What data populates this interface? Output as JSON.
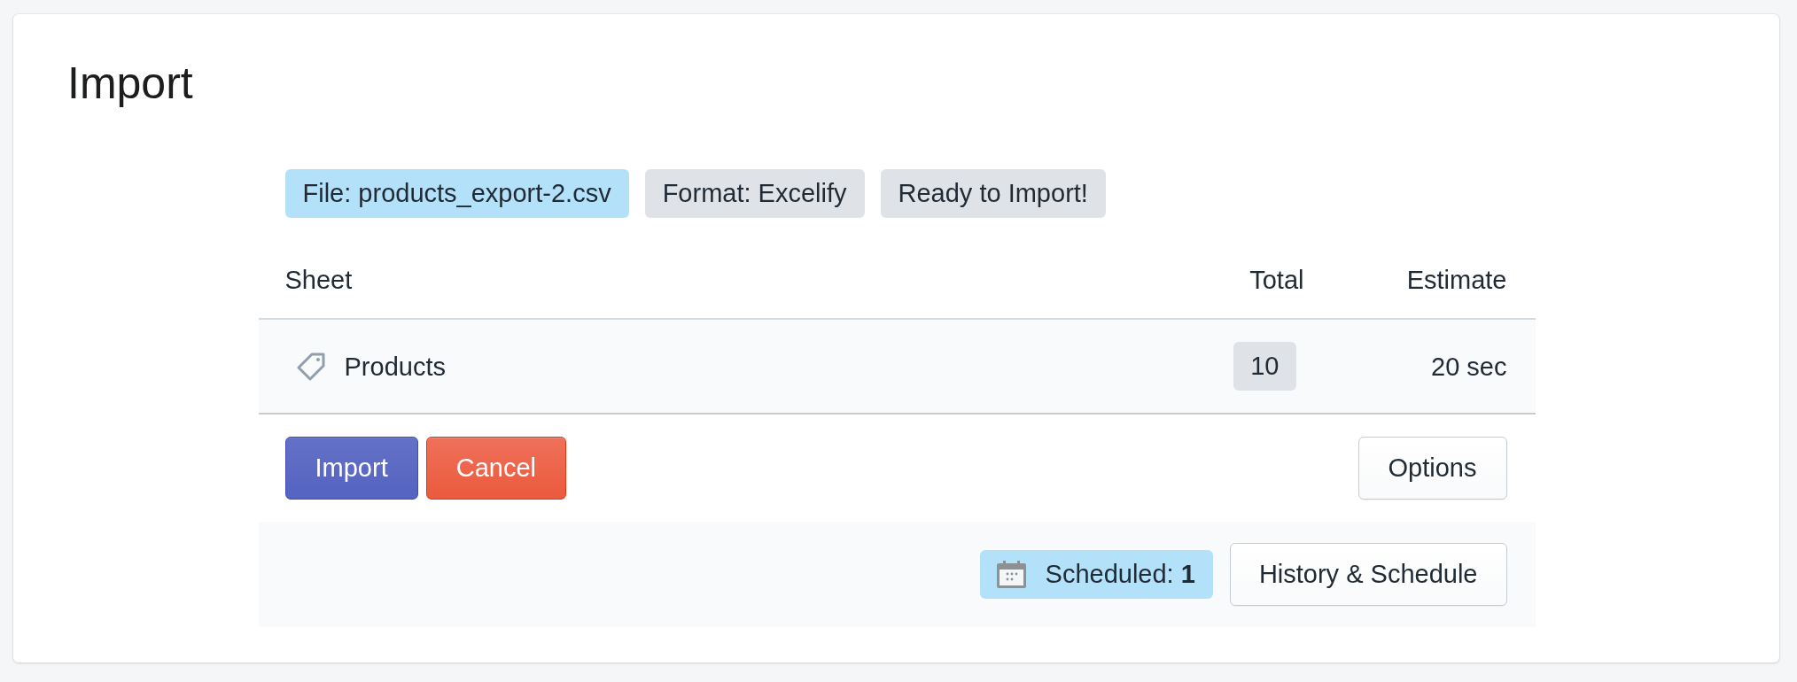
{
  "page": {
    "title": "Import"
  },
  "badges": [
    {
      "label": "File: products_export-2.csv",
      "color": "#b4e1fa"
    },
    {
      "label": "Format: Excelify",
      "color": "#dfe3e8"
    },
    {
      "label": "Ready to Import!",
      "color": "#dfe3e8"
    }
  ],
  "table": {
    "columns": [
      "Sheet",
      "Total",
      "Estimate"
    ],
    "rows": [
      {
        "sheet": "Products",
        "total": "10",
        "estimate": "20 sec"
      }
    ]
  },
  "actions": [
    {
      "label": "Import",
      "kind": "primary"
    },
    {
      "label": "Cancel",
      "kind": "destructive"
    },
    {
      "label": "Options",
      "kind": "secondary"
    }
  ],
  "footer": {
    "scheduled": "Scheduled: **1**",
    "button": "History & Schedule"
  }
}
